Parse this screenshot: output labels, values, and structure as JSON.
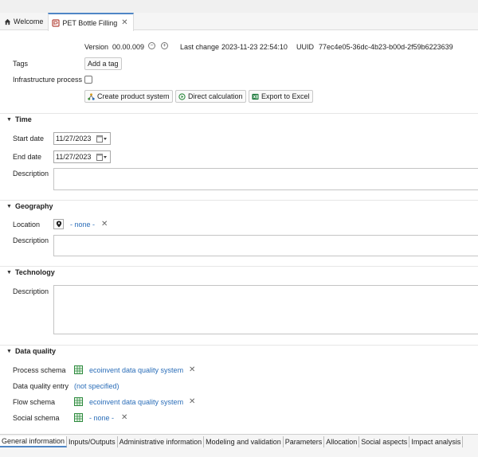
{
  "tabs": [
    {
      "label": "Welcome"
    },
    {
      "label": "PET Bottle Filling"
    }
  ],
  "header": {
    "version_label": "Version",
    "version_value": "00.00.009",
    "last_change_label": "Last change",
    "last_change_value": "2023-11-23 22:54:10",
    "uuid_label": "UUID",
    "uuid_value": "77ec4e05-36dc-4b23-b00d-2f59b6223639"
  },
  "tags": {
    "label": "Tags",
    "button": "Add a tag"
  },
  "infrastructure": {
    "label": "Infrastructure process",
    "checked": false
  },
  "actions": {
    "create": "Create product system",
    "direct": "Direct calculation",
    "export": "Export to Excel"
  },
  "time": {
    "title": "Time",
    "start_label": "Start date",
    "start_value": "11/27/2023",
    "end_label": "End date",
    "end_value": "11/27/2023",
    "description_label": "Description",
    "description_value": ""
  },
  "geography": {
    "title": "Geography",
    "location_label": "Location",
    "location_value": "- none -",
    "description_label": "Description",
    "description_value": ""
  },
  "technology": {
    "title": "Technology",
    "description_label": "Description",
    "description_value": ""
  },
  "data_quality": {
    "title": "Data quality",
    "process_schema_label": "Process schema",
    "process_schema_value": "ecoinvent data quality system",
    "entry_label": "Data quality entry",
    "entry_value": "(not specified)",
    "flow_schema_label": "Flow schema",
    "flow_schema_value": "ecoinvent data quality system",
    "social_schema_label": "Social schema",
    "social_schema_value": "- none -"
  },
  "bottom_tabs": [
    {
      "label": "General information"
    },
    {
      "label": "Inputs/Outputs"
    },
    {
      "label": "Administrative information"
    },
    {
      "label": "Modeling and validation"
    },
    {
      "label": "Parameters"
    },
    {
      "label": "Allocation"
    },
    {
      "label": "Social aspects"
    },
    {
      "label": "Impact analysis"
    }
  ],
  "colors": {
    "accent": "#4f86c6",
    "link": "#2a6db8",
    "excel_green": "#1f7a3e"
  },
  "icons": {
    "home": "home-icon",
    "process": "process-icon",
    "map_pin": "map-pin-icon",
    "grid": "grid-icon",
    "calendar": "calendar-icon"
  }
}
